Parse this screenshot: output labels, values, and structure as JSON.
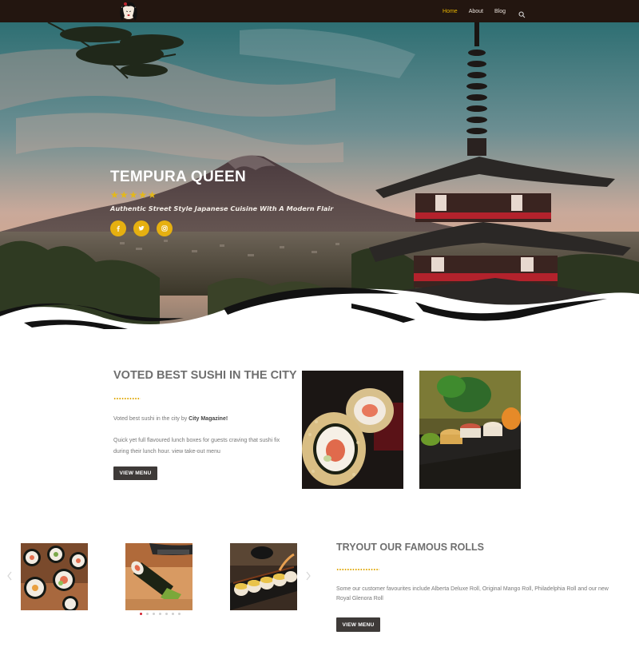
{
  "nav": {
    "logo_icon": "geisha-logo-icon",
    "links": [
      {
        "label": "Home",
        "active": true
      },
      {
        "label": "About",
        "active": false
      },
      {
        "label": "Blog",
        "active": false
      }
    ],
    "search_icon": "search-icon"
  },
  "hero": {
    "title": "TEMPURA QUEEN",
    "rating": 5,
    "subtitle": "Authentic Street Style Japanese Cuisine With A Modern Flair",
    "social": [
      "facebook-icon",
      "twitter-icon",
      "instagram-icon"
    ]
  },
  "section_best": {
    "title": "VOTED BEST SUSHI IN THE CITY",
    "text_prefix": "Voted best sushi in the city by ",
    "text_bold": "City Magazine!",
    "paragraph": "Quick yet full flavoured lunch boxes for guests craving that sushi fix during their lunch hour. view take-out menu",
    "button": "VIEW MENU"
  },
  "section_rolls": {
    "title": "TRYOUT OUR FAMOUS ROLLS",
    "paragraph": "Some our customer favourites include Alberta Deluxe Roll, Original Mango Roll, Philadelphia Roll and our new Royal Glenora Roll",
    "button": "VIEW MENU",
    "carousel_dots": 7,
    "active_dot": 0
  },
  "colors": {
    "nav_bg": "#231610",
    "accent": "#e6b010",
    "button_bg": "#3e3a38",
    "active_dot": "#d21f2f"
  }
}
